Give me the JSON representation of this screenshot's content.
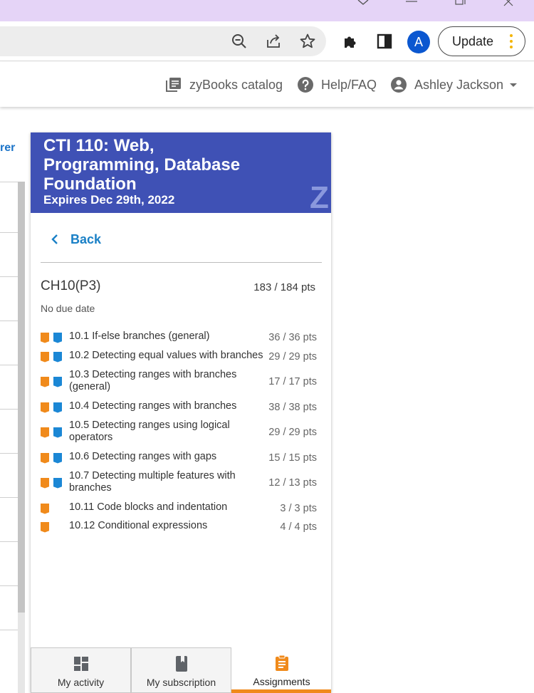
{
  "browser": {
    "update_label": "Update",
    "avatar_letter": "A"
  },
  "appbar": {
    "catalog_label": "zyBooks catalog",
    "help_label": "Help/FAQ",
    "user_name": "Ashley Jackson"
  },
  "left": {
    "fragment_text": "rer"
  },
  "course": {
    "title": "CTI 110: Web, Programming, Database Foundation",
    "expires": "Expires Dec 29th, 2022",
    "logo_letter": "Z"
  },
  "assignment": {
    "back_label": "Back",
    "chapter": "CH10(P3)",
    "points": "183 / 184 pts",
    "due": "No due date",
    "sections": [
      {
        "label": "10.1 If-else branches (general)",
        "pts": "36 / 36 pts",
        "flags": [
          "orange",
          "blue"
        ]
      },
      {
        "label": "10.2 Detecting equal values with branches",
        "pts": "29 / 29 pts",
        "flags": [
          "orange",
          "blue"
        ]
      },
      {
        "label": "10.3 Detecting ranges with branches (general)",
        "pts": "17 / 17 pts",
        "flags": [
          "orange",
          "blue"
        ]
      },
      {
        "label": "10.4 Detecting ranges with branches",
        "pts": "38 / 38 pts",
        "flags": [
          "orange",
          "blue"
        ]
      },
      {
        "label": "10.5 Detecting ranges using logical operators",
        "pts": "29 / 29 pts",
        "flags": [
          "orange",
          "blue"
        ]
      },
      {
        "label": "10.6 Detecting ranges with gaps",
        "pts": "15 / 15 pts",
        "flags": [
          "orange",
          "blue"
        ]
      },
      {
        "label": "10.7 Detecting multiple features with branches",
        "pts": "12 / 13 pts",
        "flags": [
          "orange",
          "blue"
        ]
      },
      {
        "label": "10.11 Code blocks and indentation",
        "pts": "3 / 3 pts",
        "flags": [
          "orange"
        ]
      },
      {
        "label": "10.12 Conditional expressions",
        "pts": "4 / 4 pts",
        "flags": [
          "orange"
        ]
      }
    ]
  },
  "bottom_nav": {
    "activity_label": "My activity",
    "subscription_label": "My subscription",
    "assignments_label": "Assignments"
  },
  "colors": {
    "header_blue": "#3f51b5",
    "link_blue": "#1a80c6",
    "accent_orange": "#f08a1b",
    "flag_blue": "#1b87d5",
    "titlebar_purple": "#e5d4f7"
  }
}
